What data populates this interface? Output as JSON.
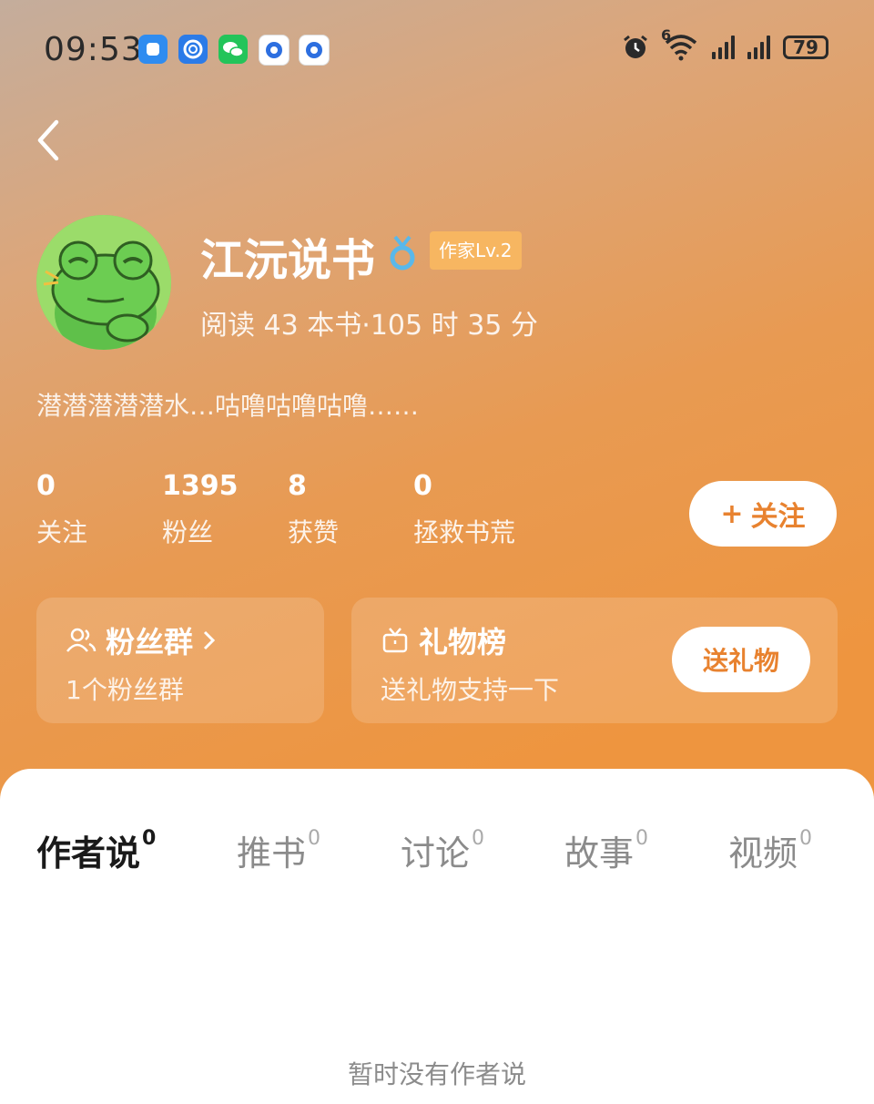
{
  "status_bar": {
    "time": "09:53",
    "battery": "79",
    "network_badge": "6",
    "app_icons": [
      {
        "name": "chat-app-icon",
        "color": "#2f8cf0"
      },
      {
        "name": "browser-app-icon",
        "color": "#2b7be8"
      },
      {
        "name": "wechat-icon",
        "color": "#23c45a"
      },
      {
        "name": "circle-app-icon",
        "color": "#2d6fe0"
      },
      {
        "name": "circle-app-icon-2",
        "color": "#2d6fe0"
      }
    ]
  },
  "profile": {
    "name": "江沅说书",
    "level_badge": "作家Lv.2",
    "reading": {
      "prefix": "阅读",
      "books": "43",
      "books_unit": "本书·",
      "hours": "105",
      "hours_unit": "时",
      "minutes": "35",
      "minutes_unit": "分"
    },
    "bio": "潜潜潜潜潜水…咕噜咕噜咕噜……"
  },
  "stats": [
    {
      "value": "0",
      "label": "关注"
    },
    {
      "value": "1395",
      "label": "粉丝"
    },
    {
      "value": "8",
      "label": "获赞"
    },
    {
      "value": "0",
      "label": "拯救书荒"
    }
  ],
  "follow_button": {
    "plus": "+",
    "label": "关注"
  },
  "fan_group": {
    "title": "粉丝群",
    "subtitle": "1个粉丝群"
  },
  "gift_board": {
    "title": "礼物榜",
    "subtitle": "送礼物支持一下",
    "button": "送礼物"
  },
  "tabs": [
    {
      "label": "作者说",
      "count": "0",
      "active": true
    },
    {
      "label": "推书",
      "count": "0"
    },
    {
      "label": "讨论",
      "count": "0"
    },
    {
      "label": "故事",
      "count": "0"
    },
    {
      "label": "视频",
      "count": "0"
    }
  ],
  "empty_text": "暂时没有作者说",
  "colors": {
    "accent": "#e8822f",
    "badge": "#f7b661"
  }
}
